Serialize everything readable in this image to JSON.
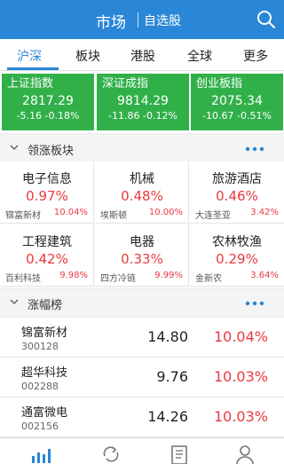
{
  "header": {
    "title": "市场",
    "subtitle": "自选股"
  },
  "tabs": [
    {
      "label": "沪深"
    },
    {
      "label": "板块"
    },
    {
      "label": "港股"
    },
    {
      "label": "全球"
    },
    {
      "label": "更多"
    }
  ],
  "indices": [
    {
      "name": "上证指数",
      "price": "2817.29",
      "change": "-5.16 -0.18%"
    },
    {
      "name": "深证成指",
      "price": "9814.29",
      "change": "-11.86 -0.12%"
    },
    {
      "name": "创业板指",
      "price": "2075.34",
      "change": "-10.67 -0.51%"
    }
  ],
  "sectors_section": {
    "label": "领涨板块"
  },
  "sectors": [
    {
      "name": "电子信息",
      "pct": "0.97%",
      "stock": "锦富新材",
      "stock_pct": "10.04%"
    },
    {
      "name": "机械",
      "pct": "0.48%",
      "stock": "埃斯顿",
      "stock_pct": "10.00%"
    },
    {
      "name": "旅游酒店",
      "pct": "0.46%",
      "stock": "大连圣亚",
      "stock_pct": "3.42%"
    },
    {
      "name": "工程建筑",
      "pct": "0.42%",
      "stock": "百利科技",
      "stock_pct": "9.98%"
    },
    {
      "name": "电器",
      "pct": "0.33%",
      "stock": "四方冷链",
      "stock_pct": "9.99%"
    },
    {
      "name": "农林牧渔",
      "pct": "0.29%",
      "stock": "金新农",
      "stock_pct": "3.64%"
    }
  ],
  "gainers_section": {
    "label": "涨幅榜"
  },
  "gainers": [
    {
      "name": "锦富新材",
      "code": "300128",
      "price": "14.80",
      "pct": "10.04%"
    },
    {
      "name": "超华科技",
      "code": "002288",
      "price": "9.76",
      "pct": "10.03%"
    },
    {
      "name": "通富微电",
      "code": "002156",
      "price": "14.26",
      "pct": "10.03%"
    }
  ],
  "colors": {
    "brand": "#2a86d6",
    "up": "#e8393f",
    "index_bg": "#31b04a"
  },
  "bottom_nav": [
    {
      "icon": "market-chart-icon",
      "active": true
    },
    {
      "icon": "refresh-link-icon",
      "active": false
    },
    {
      "icon": "news-doc-icon",
      "active": false
    },
    {
      "icon": "user-icon",
      "active": false
    }
  ]
}
